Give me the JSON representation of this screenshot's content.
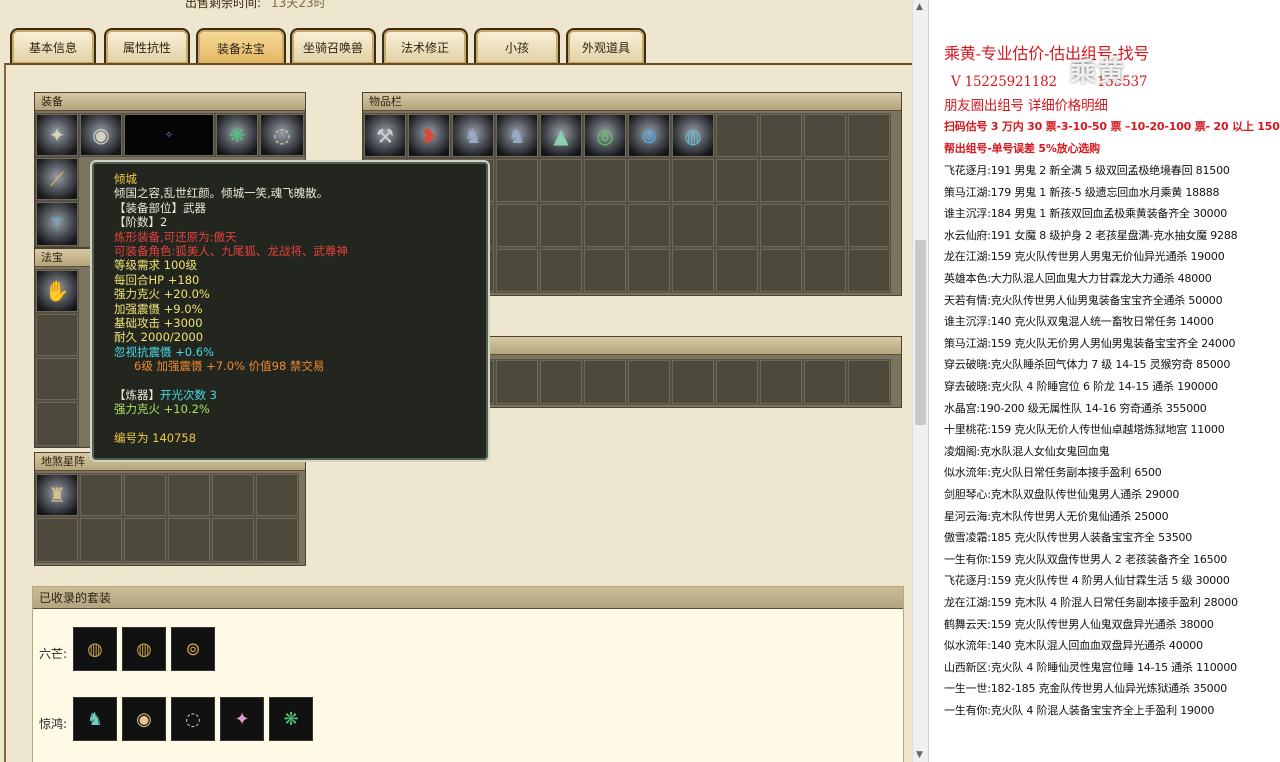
{
  "header": {
    "remaining_label": "出售剩余时间:",
    "remaining_value": "13天23时"
  },
  "tabs": [
    {
      "label": "基本信息"
    },
    {
      "label": "属性抗性"
    },
    {
      "label": "装备法宝",
      "active": true
    },
    {
      "label": "坐骑召唤兽"
    },
    {
      "label": "法术修正"
    },
    {
      "label": "小孩"
    },
    {
      "label": "外观道具"
    }
  ],
  "panels": {
    "equipment": "装备",
    "inventory": "物品栏",
    "treasure": "法宝",
    "earthly": "地煞星阵",
    "sets": "已收录的套装"
  },
  "inventory_icons": [
    "axe-icon",
    "shoes-icon",
    "boots-icon",
    "boots-icon",
    "cloak-icon",
    "wreath-icon",
    "bracelet-icon",
    "ring-icon"
  ],
  "tooltip": {
    "name": "倾城",
    "desc": "倾国之容,乱世红颜。倾城一笑,魂飞魄散。",
    "slot": "【装备部位】武器",
    "tier": "【阶数】2",
    "refine": "炼形装备,可还原为:傲天",
    "usable": "可装备角色:狐美人、九尾狐、龙战将、武尊神",
    "level": "等级需求 100级",
    "hp": "每回合HP +180",
    "fire": "强力克火 +20.0%",
    "shock": "加强震慑 +9.0%",
    "attack": "基础攻击 +3000",
    "durability": "耐久 2000/2000",
    "ignore": "忽视抗震慑 +0.6%",
    "bonus": "6级 加强震慑 +7.0% 价值98 禁交易",
    "forge_label": "【炼器】",
    "forge_value": "开光次数 3",
    "fire2": "强力克火 +10.2%",
    "serial": "编号为 140758"
  },
  "sets": [
    {
      "label": "六芒:",
      "items": [
        "ring-icon",
        "ring-icon",
        "bracelet-icon"
      ]
    },
    {
      "label": "惊鸿:",
      "items": [
        "boots-icon",
        "helmet-icon",
        "necklace-icon",
        "claw-icon",
        "mask-icon"
      ]
    }
  ],
  "doc": {
    "title": "乘黄-专业估价-估出组号-找号",
    "contact": "V 15225921182",
    "contact2": "155537",
    "watermark": "乘黄",
    "line3": "朋友圈出组号    详细价格明细",
    "line4": "扫码估号 3 万内 30 票-3-10-50 票 –10-20-100 票- 20 以上 150",
    "line5": "帮出组号-单号误差 5%放心选购",
    "entries": [
      "飞花逐月:191 男鬼 2 新全满 5 级双回孟极绝境春回 81500",
      "策马江湖:179 男鬼 1 新孩-5 级遗忘回血水月乘黄 18888",
      "谁主沉浮:184 男鬼 1 新孩双回血孟极乘黄装备齐全 30000",
      "水云仙府:191 女魔 8 级护身 2 老孩星盘满-克水抽女魔 9288",
      "龙在江湖:159 克火队传世男人男鬼无价仙异光通杀 19000",
      "英雄本色:大力队混人回血鬼大力甘霖龙大力通杀 48000",
      "天若有情:克火队传世男人仙男鬼装备宝宝齐全通杀 50000",
      "谁主沉浮:140 克火队双鬼混人统一畜牧日常任务 14000",
      "策马江湖:159 克火队无价男人男仙男鬼装备宝宝齐全 24000",
      "穿云破晓:克火队睡杀回气体力 7 级 14-15 灵猴穷奇 85000",
      "穿去破晓:克火队 4 阶睡宫位 6 阶龙 14-15 通杀 190000",
      "水晶宫:190-200 级无属性队 14-16 穷奇通杀 355000",
      "十里桃花:159 克火队无价人传世仙卓越塔炼狱地宫 11000",
      "凌烟阁:克水队混人女仙女鬼回血鬼",
      "似水流年:克火队日常任务副本接手盈利 6500",
      "剑胆琴心:克木队双盘队传世仙鬼男人通杀 29000",
      "星河云海:克木队传世男人无价鬼仙通杀 25000",
      "傲雪凌霜:185 克火队传世男人装备宝宝齐全 53500",
      "一生有你:159 克火队双盘传世男人 2 老孩装备齐全 16500",
      "飞花逐月:159 克火队传世 4 阶男人仙甘霖生活 5 级 30000",
      "龙在江湖:159 克木队 4 阶混人日常任务副本接手盈利 28000",
      "鹤舞云天:159 克火队传世男人仙鬼双盘异光通杀 38000",
      "似水流年:140 克木队混人回血血双盘异光通杀 40000",
      "山西新区:克火队 4 阶睡仙灵性鬼宫位睡 14-15 通杀 110000",
      "一生一世:182-185 克金队传世男人仙异光炼狱通杀 35000",
      "一生有你:克火队 4 阶混人装备宝宝齐全上手盈利 19000"
    ]
  }
}
